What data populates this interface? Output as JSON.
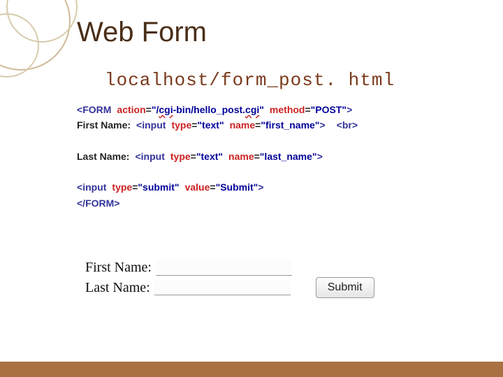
{
  "slide": {
    "title": "Web Form",
    "url": "localhost/form_post. html"
  },
  "code": {
    "line1": {
      "open_lt": "<",
      "tag": "FORM",
      "attr1_name": "action",
      "eq": "=",
      "val1_pre": "\"/",
      "val1_sq1": "cgi",
      "val1_mid": "-bin/hello_post.",
      "val1_sq2": "cgi",
      "val1_post": "\"",
      "sp": " ",
      "attr2_name": "method",
      "val2": "\"POST\"",
      "gt": ">"
    },
    "line2": {
      "label": "First Name:",
      "open_lt": "<",
      "tag": "input",
      "attr1_name": "type",
      "val1": "\"text\"",
      "attr2_name": "name",
      "val2": "\"first_name\"",
      "gt": ">",
      "br": "<br>"
    },
    "line4": {
      "label": "Last Name:",
      "open_lt": "<",
      "tag": "input",
      "attr1_name": "type",
      "val1": "\"text\"",
      "attr2_name": "name",
      "val2": "\"last_name\"",
      "gt": ">"
    },
    "line6": {
      "open_lt": "<",
      "tag": "input",
      "attr1_name": "type",
      "val1": "\"submit\"",
      "attr2_name": "value",
      "val2": "\"Submit\"",
      "gt": ">"
    },
    "line7": {
      "close": "</FORM>"
    }
  },
  "form": {
    "first_label": "First Name:",
    "last_label": "Last Name:",
    "submit_label": "Submit",
    "first_value": "",
    "last_value": ""
  }
}
